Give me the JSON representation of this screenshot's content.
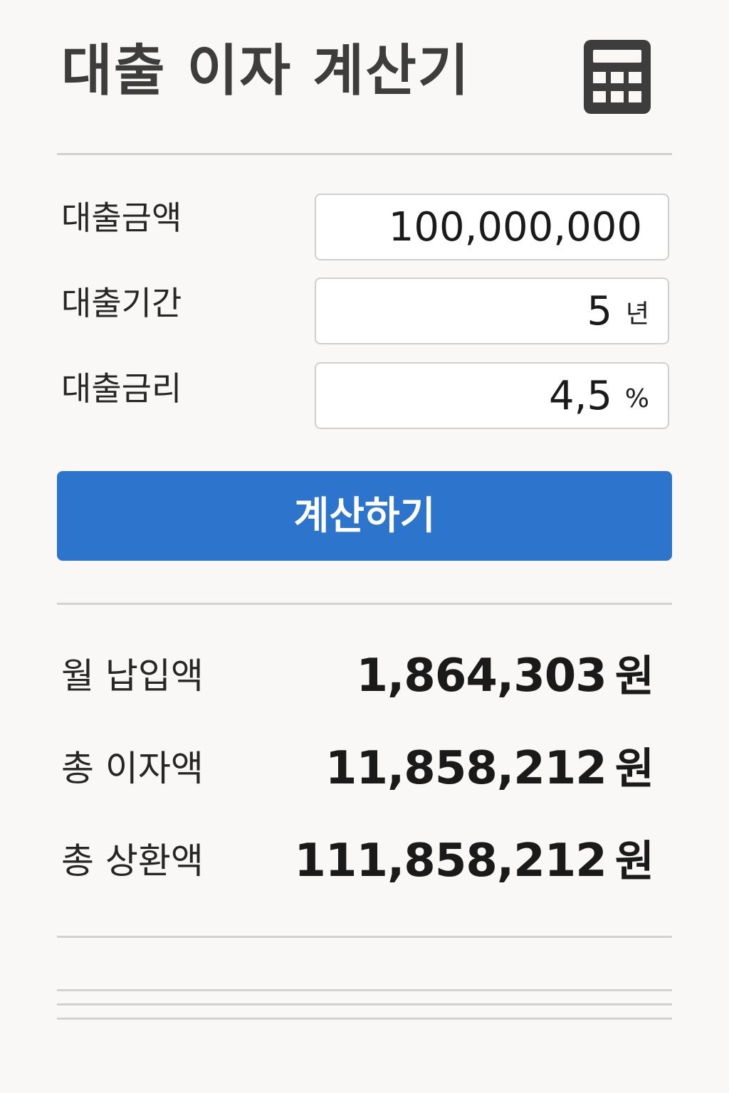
{
  "header": {
    "title": "대출 이자 계산기",
    "icon": "calculator-icon"
  },
  "form": {
    "amount": {
      "label": "대출금액",
      "value": "100,000,000"
    },
    "period": {
      "label": "대출기간",
      "value": "5",
      "unit": "년"
    },
    "rate": {
      "label": "대출금리",
      "value": "4,5",
      "unit": "%"
    }
  },
  "button": {
    "label": "계산하기"
  },
  "results": {
    "monthly": {
      "label": "월 납입액",
      "value": "1,864,303",
      "unit": "원"
    },
    "total_interest": {
      "label": "총 이자액",
      "value": "11,858,212",
      "unit": "원"
    },
    "total_repayment": {
      "label": "총 상환액",
      "value": "111,858,212",
      "unit": "원"
    }
  },
  "colors": {
    "background": "#faf8f6",
    "accent": "#2c74cc",
    "title": "#3d3d3d",
    "divider": "#d1d1d1"
  }
}
